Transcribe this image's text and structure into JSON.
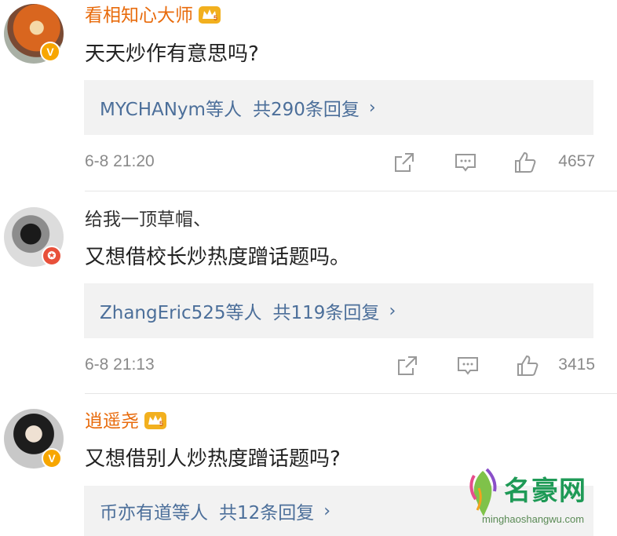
{
  "comments": [
    {
      "username": "看相知心大师",
      "verified": "V",
      "text": "天天炒作有意思吗?",
      "reply_who": "MYCHANym等人",
      "reply_count": "共290条回复",
      "time": "6-8 21:20",
      "likes": "4657"
    },
    {
      "username": "给我一顶草帽、",
      "verified": "✪",
      "text": "又想借校长炒热度蹭话题吗。",
      "reply_who": "ZhangEric525等人",
      "reply_count": "共119条回复",
      "time": "6-8 21:13",
      "likes": "3415"
    },
    {
      "username": "逍遥尧",
      "verified": "V",
      "text": "又想借别人炒热度蹭话题吗?",
      "reply_who": "币亦有道等人",
      "reply_count": "共12条回复"
    }
  ],
  "chevron": "›",
  "watermark": {
    "name": "名豪网",
    "domain": "minghaoshangwu.com"
  },
  "colors": {
    "vip_name": "#e86b0c",
    "link": "#4c6f9a",
    "reply_bg": "#f2f2f2",
    "verified_orange": "#f7a600",
    "verified_red": "#e8503a"
  },
  "icons": [
    "crown-icon",
    "share-icon",
    "comment-icon",
    "like-icon",
    "chevron-right-icon"
  ]
}
